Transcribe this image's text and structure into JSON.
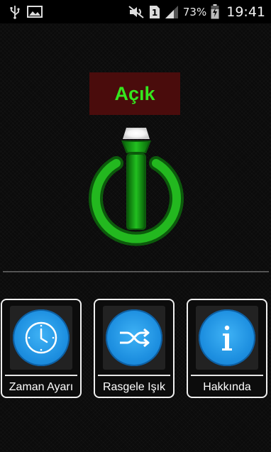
{
  "status_bar": {
    "battery_percent": "73%",
    "time": "19:41",
    "sim_slot": "1",
    "icons": [
      "usb-icon",
      "image-icon",
      "mute-icon",
      "sim-icon",
      "signal-icon",
      "battery-charging-icon"
    ]
  },
  "flashlight": {
    "state_label": "Açık",
    "state_color": "#35e61e",
    "label_background": "#4a0c0c",
    "toggle_icon": "power-flashlight-icon"
  },
  "menu": {
    "items": [
      {
        "label": "Zaman Ayarı",
        "icon": "clock-icon"
      },
      {
        "label": "Rasgele Işık",
        "icon": "shuffle-icon"
      },
      {
        "label": "Hakkında",
        "icon": "info-icon"
      }
    ],
    "accent_color": "#1d8fe0"
  }
}
